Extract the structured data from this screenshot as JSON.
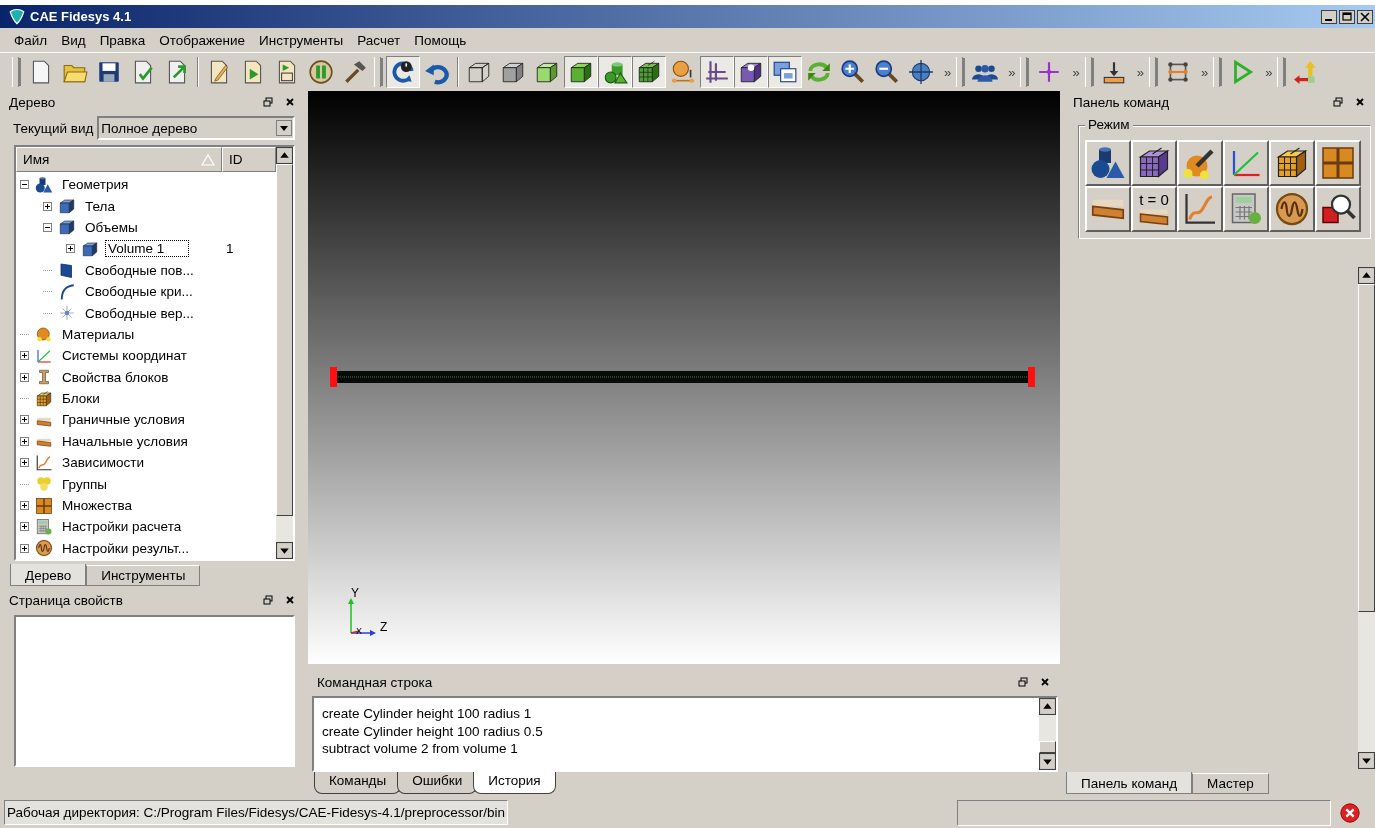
{
  "window": {
    "title": "CAE Fidesys 4.1"
  },
  "menu": [
    "Файл",
    "Вид",
    "Правка",
    "Отображение",
    "Инструменты",
    "Расчет",
    "Помощь"
  ],
  "toolbars": [
    {
      "sections": [
        [
          {
            "pressed": false
          },
          {
            "pressed": false
          },
          {
            "pressed": false
          },
          {
            "pressed": false
          },
          {
            "pressed": false
          }
        ],
        [
          {
            "pressed": false
          },
          {
            "pressed": false
          },
          {
            "pressed": false
          },
          {
            "pressed": false
          },
          {
            "pressed": false
          }
        ]
      ]
    },
    {
      "sections": [
        [
          {
            "pressed": true
          },
          {
            "pressed": false
          }
        ],
        [
          {
            "pressed": false
          },
          {
            "pressed": false
          },
          {
            "pressed": false
          },
          {
            "pressed": true
          },
          {
            "pressed": true
          },
          {
            "pressed": true
          },
          {
            "pressed": false
          },
          {
            "pressed": true
          },
          {
            "pressed": true
          },
          {
            "pressed": true
          },
          {
            "pressed": false
          },
          {
            "pressed": false
          },
          {
            "pressed": false
          },
          {
            "pressed": false
          }
        ]
      ],
      "overflow": "»"
    },
    {
      "sections": [
        [
          {
            "pressed": false
          }
        ]
      ],
      "overflow": "»"
    },
    {
      "sections": [
        [
          {
            "pressed": false
          }
        ]
      ],
      "overflow": "»"
    },
    {
      "sections": [
        [
          {
            "pressed": false
          }
        ]
      ],
      "overflow": "»"
    },
    {
      "sections": [
        [
          {
            "pressed": false
          }
        ]
      ],
      "overflow": "»"
    },
    {
      "sections": [
        [
          {
            "pressed": false
          }
        ]
      ],
      "overflow": "»"
    },
    {
      "sections": [
        [
          {
            "pressed": false
          }
        ]
      ]
    }
  ],
  "tree_panel": {
    "title": "Дерево",
    "view_label": "Текущий вид",
    "view_value": "Полное дерево",
    "columns": [
      "Имя",
      "ID"
    ],
    "items": [
      {
        "label": "Геометрия",
        "expanded": true,
        "children": [
          {
            "label": "Тела",
            "expanded": false
          },
          {
            "label": "Объемы",
            "expanded": true,
            "children": [
              {
                "label": "Volume 1",
                "expanded": false,
                "id": "1",
                "focused": true
              }
            ]
          },
          {
            "label": "Свободные пов..."
          },
          {
            "label": "Свободные кри..."
          },
          {
            "label": "Свободные вер..."
          }
        ]
      },
      {
        "label": "Материалы"
      },
      {
        "label": "Системы координат",
        "expanded": false
      },
      {
        "label": "Свойства блоков",
        "expanded": false
      },
      {
        "label": "Блоки"
      },
      {
        "label": "Граничные условия",
        "expanded": false
      },
      {
        "label": "Начальные условия",
        "expanded": false
      },
      {
        "label": "Зависимости",
        "expanded": false
      },
      {
        "label": "Группы"
      },
      {
        "label": "Множества",
        "expanded": false
      },
      {
        "label": "Настройки расчета",
        "expanded": false
      },
      {
        "label": "Настройки результ...",
        "expanded": false
      }
    ]
  },
  "left_tabs": [
    {
      "label": "Дерево",
      "selected": true
    },
    {
      "label": "Инструменты",
      "selected": false
    }
  ],
  "properties_panel": {
    "title": "Страница свойств"
  },
  "viewport": {
    "axes": {
      "y": "Y",
      "x": "X",
      "z": "Z"
    }
  },
  "command_line": {
    "title": "Командная строка",
    "lines": [
      "create Cylinder height 100 radius 1",
      "create Cylinder height 100 radius 0.5",
      "subtract volume 2 from volume 1"
    ],
    "tabs": [
      {
        "label": "Команды",
        "selected": false
      },
      {
        "label": "Ошибки",
        "selected": false
      },
      {
        "label": "История",
        "selected": true
      }
    ]
  },
  "command_panel": {
    "title": "Панель команд",
    "group": "Режим",
    "buttons": [
      {
        "pressed": false
      },
      {
        "pressed": false
      },
      {
        "pressed": false
      },
      {
        "pressed": false
      },
      {
        "pressed": false
      },
      {
        "pressed": false
      },
      {
        "pressed": false
      },
      {
        "pressed": false,
        "text": "t = 0"
      },
      {
        "pressed": false
      },
      {
        "pressed": false
      },
      {
        "pressed": false
      },
      {
        "pressed": false
      }
    ]
  },
  "right_tabs": [
    {
      "label": "Панель команд",
      "selected": true
    },
    {
      "label": "Мастер",
      "selected": false
    }
  ],
  "status_bar": {
    "text": "Рабочая директория: C:/Program Files/Fidesys/CAE-Fidesys-4.1/preprocessor/bin"
  }
}
